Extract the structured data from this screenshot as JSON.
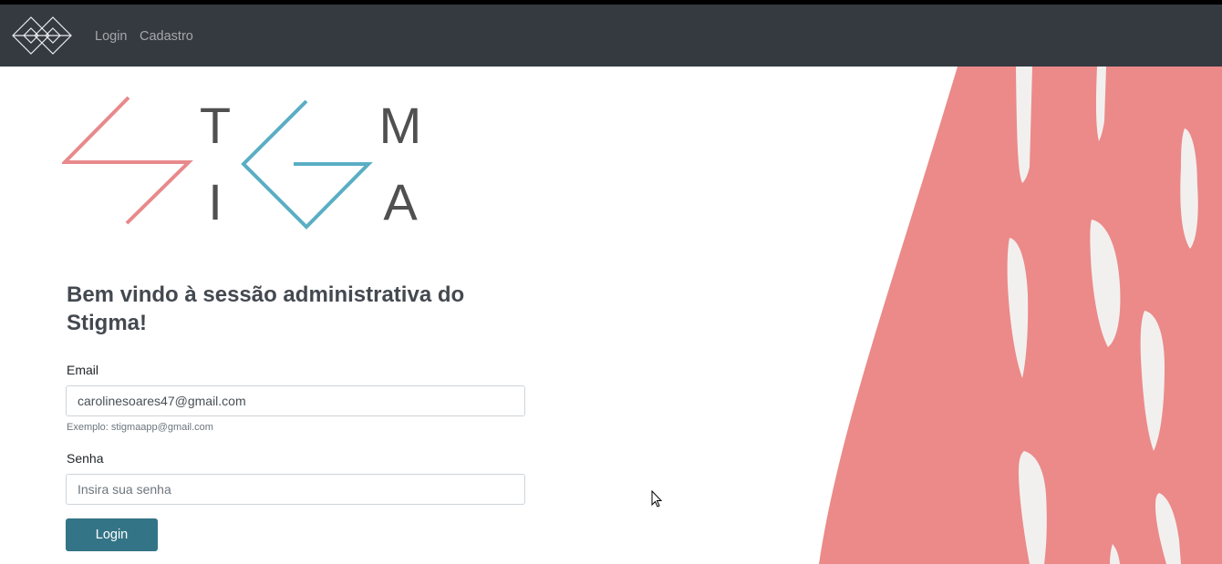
{
  "navbar": {
    "links": [
      "Login",
      "Cadastro"
    ],
    "brand_icon": "diamond-logo-icon",
    "background": "#343a40"
  },
  "logo": {
    "letters": [
      "T",
      "M",
      "I",
      "A"
    ],
    "colors": {
      "pink": "#e8898b",
      "teal": "#5aaec4",
      "letters": "#505050"
    }
  },
  "main": {
    "heading": "Bem vindo à sessão administrativa do Stigma!",
    "email": {
      "label": "Email",
      "value": "carolinesoares47@gmail.com",
      "hint": "Exemplo: stigmaapp@gmail.com"
    },
    "password": {
      "label": "Senha",
      "placeholder": "Insira sua senha",
      "value": ""
    },
    "submit_label": "Login",
    "button_color": "#347487"
  },
  "decor": {
    "color": "#eb8a89",
    "stroke_color": "#f2f0ef"
  }
}
